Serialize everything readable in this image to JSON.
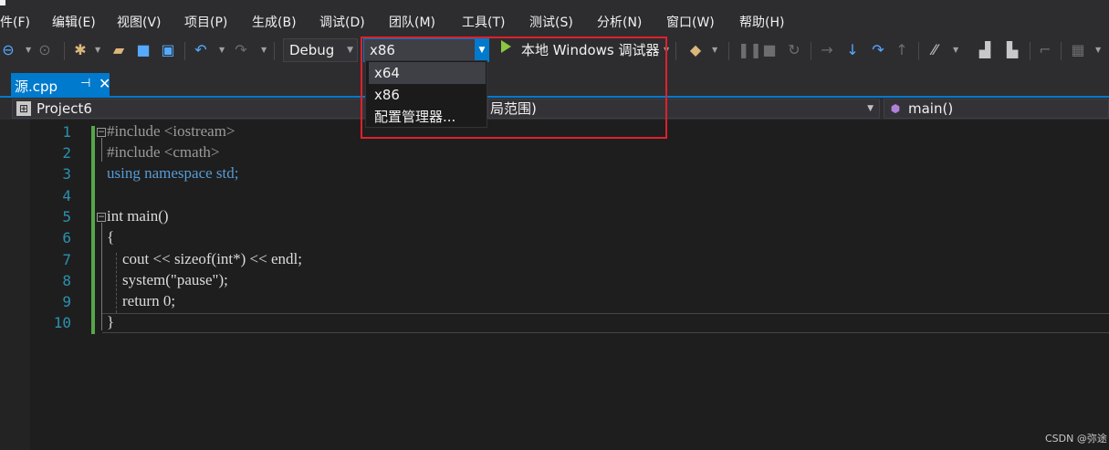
{
  "menu": [
    "件(F)",
    "编辑(E)",
    "视图(V)",
    "项目(P)",
    "生成(B)",
    "调试(D)",
    "团队(M)",
    "工具(T)",
    "测试(S)",
    "分析(N)",
    "窗口(W)",
    "帮助(H)"
  ],
  "toolbar": {
    "configuration": "Debug",
    "platform": "x86",
    "run_label": "本地 Windows 调试器"
  },
  "platform_dropdown": {
    "options": [
      "x64",
      "x86",
      "配置管理器..."
    ],
    "highlighted": "x64"
  },
  "tab": {
    "file_name": "源.cpp",
    "pin_glyph": "⊣",
    "close_glyph": "✕"
  },
  "navbar": {
    "project": "Project6",
    "scope": "局范围)",
    "member": "main()"
  },
  "editor": {
    "line_numbers": [
      "1",
      "2",
      "3",
      "4",
      "5",
      "6",
      "7",
      "8",
      "9",
      "10"
    ],
    "lines": [
      "#include <iostream>",
      "#include <cmath>",
      "using namespace std;",
      "",
      "int main()",
      "{",
      "    cout << sizeof(int*) << endl;",
      "    system(\"pause\");",
      "    return 0;",
      "}"
    ]
  },
  "watermark": "CSDN @弥途",
  "colors": {
    "accent": "#007acc",
    "highlight_border": "#e0202c",
    "keyword": "#569cd6",
    "string": "#d69d85",
    "line_number": "#2b91af",
    "change_bar": "#57a64a"
  }
}
